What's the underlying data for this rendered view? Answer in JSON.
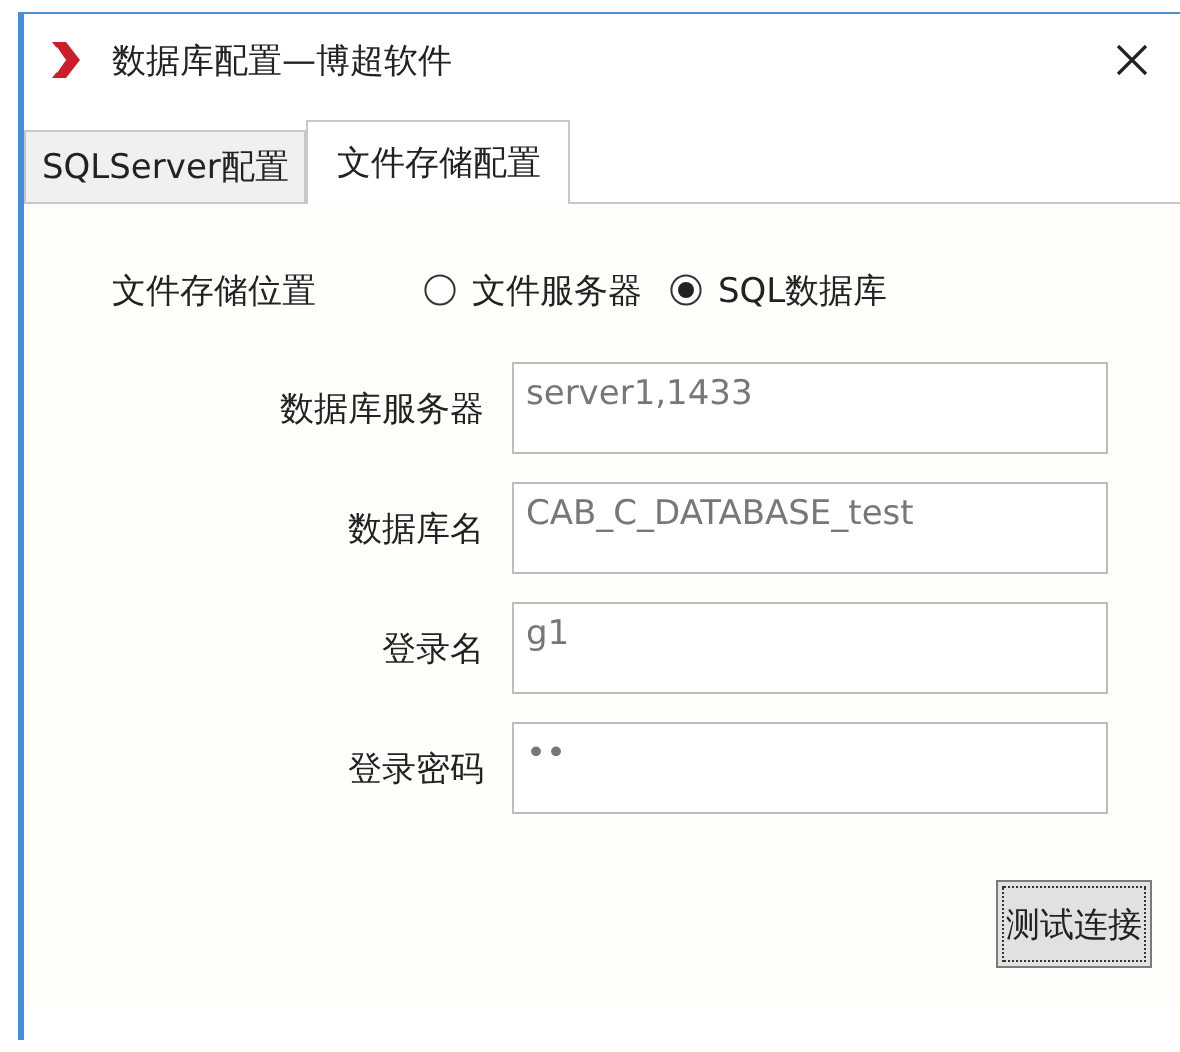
{
  "window": {
    "title": "数据库配置—博超软件"
  },
  "tabs": [
    {
      "label": "SQLServer配置",
      "selected": false
    },
    {
      "label": "文件存储配置",
      "selected": true
    }
  ],
  "storage_location": {
    "label": "文件存储位置",
    "options": [
      {
        "label": "文件服务器",
        "selected": false
      },
      {
        "label": "SQL数据库",
        "selected": true
      }
    ]
  },
  "fields": [
    {
      "label": "数据库服务器",
      "value": "server1,1433"
    },
    {
      "label": "数据库名",
      "value": "CAB_C_DATABASE_test"
    },
    {
      "label": "登录名",
      "value": "g1"
    },
    {
      "label": "登录密码",
      "value": "••"
    }
  ],
  "buttons": [
    {
      "label": "测试连接",
      "focused": true
    }
  ]
}
